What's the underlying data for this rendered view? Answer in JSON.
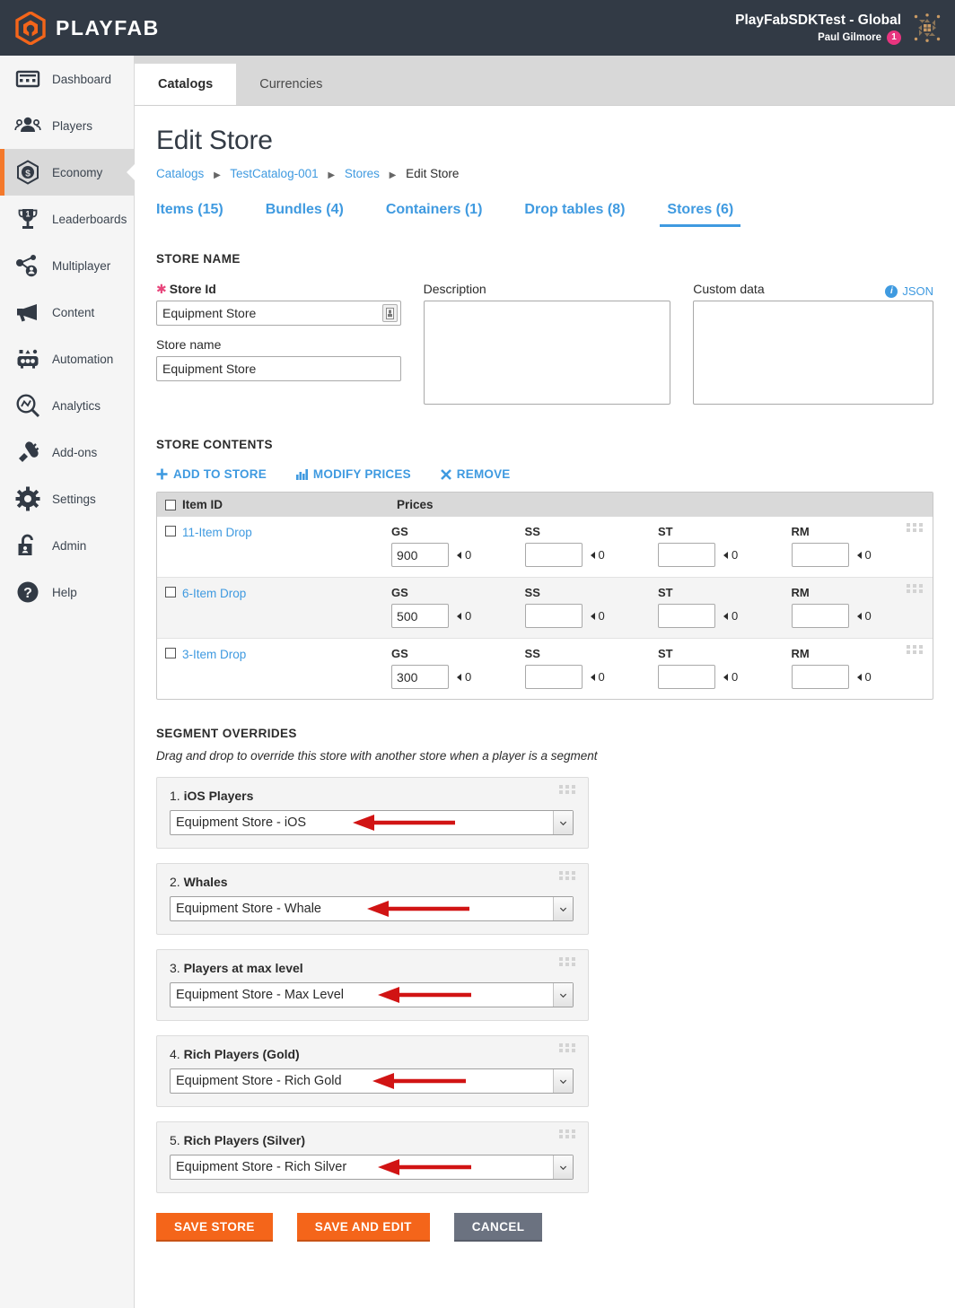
{
  "topbar": {
    "brand": "PLAYFAB",
    "studio_title": "PlayFabSDKTest - Global",
    "user_name": "Paul Gilmore",
    "notification_count": "1"
  },
  "sidebar": {
    "items": [
      {
        "label": "Dashboard",
        "icon": "dashboard-icon",
        "active": false
      },
      {
        "label": "Players",
        "icon": "players-icon",
        "active": false
      },
      {
        "label": "Economy",
        "icon": "economy-icon",
        "active": true
      },
      {
        "label": "Leaderboards",
        "icon": "trophy-icon",
        "active": false
      },
      {
        "label": "Multiplayer",
        "icon": "multiplayer-icon",
        "active": false
      },
      {
        "label": "Content",
        "icon": "megaphone-icon",
        "active": false
      },
      {
        "label": "Automation",
        "icon": "automation-icon",
        "active": false
      },
      {
        "label": "Analytics",
        "icon": "analytics-icon",
        "active": false
      },
      {
        "label": "Add-ons",
        "icon": "plug-icon",
        "active": false
      },
      {
        "label": "Settings",
        "icon": "gear-icon",
        "active": false
      },
      {
        "label": "Admin",
        "icon": "lock-icon",
        "active": false
      },
      {
        "label": "Help",
        "icon": "help-icon",
        "active": false
      }
    ]
  },
  "tabs": [
    {
      "label": "Catalogs",
      "active": true
    },
    {
      "label": "Currencies",
      "active": false
    }
  ],
  "page": {
    "title": "Edit Store",
    "breadcrumb": [
      {
        "label": "Catalogs",
        "link": true
      },
      {
        "label": "TestCatalog-001",
        "link": true
      },
      {
        "label": "Stores",
        "link": true
      },
      {
        "label": "Edit Store",
        "link": false
      }
    ],
    "subtabs": [
      {
        "label": "Items (15)",
        "active": false
      },
      {
        "label": "Bundles (4)",
        "active": false
      },
      {
        "label": "Containers (1)",
        "active": false
      },
      {
        "label": "Drop tables (8)",
        "active": false
      },
      {
        "label": "Stores (6)",
        "active": true
      }
    ]
  },
  "store_name": {
    "heading": "STORE NAME",
    "store_id_label": "Store Id",
    "store_id_value": "Equipment Store",
    "store_name_label": "Store name",
    "store_name_value": "Equipment Store",
    "description_label": "Description",
    "description_value": "",
    "custom_data_label": "Custom data",
    "custom_data_value": "",
    "json_link": "JSON"
  },
  "store_contents": {
    "heading": "STORE CONTENTS",
    "toolbar": [
      {
        "label": "ADD TO STORE",
        "icon": "plus-icon"
      },
      {
        "label": "MODIFY PRICES",
        "icon": "bar-chart-icon"
      },
      {
        "label": "REMOVE",
        "icon": "close-x-icon"
      }
    ],
    "columns": [
      "Item ID",
      "Prices"
    ],
    "price_columns": [
      "GS",
      "SS",
      "ST",
      "RM"
    ],
    "rows": [
      {
        "item_id": "11-Item Drop",
        "prices": [
          "900",
          "",
          "",
          ""
        ],
        "secondary": [
          "0",
          "0",
          "0",
          "0"
        ]
      },
      {
        "item_id": "6-Item Drop",
        "prices": [
          "500",
          "",
          "",
          ""
        ],
        "secondary": [
          "0",
          "0",
          "0",
          "0"
        ]
      },
      {
        "item_id": "3-Item Drop",
        "prices": [
          "300",
          "",
          "",
          ""
        ],
        "secondary": [
          "0",
          "0",
          "0",
          "0"
        ]
      }
    ]
  },
  "segment_overrides": {
    "heading": "SEGMENT OVERRIDES",
    "description": "Drag and drop to override this store with another store when a player is a segment",
    "cards": [
      {
        "index": "1.",
        "name": "iOS Players",
        "selected": "Equipment Store - iOS"
      },
      {
        "index": "2.",
        "name": "Whales",
        "selected": "Equipment Store - Whale"
      },
      {
        "index": "3.",
        "name": "Players at max level",
        "selected": "Equipment Store - Max Level"
      },
      {
        "index": "4.",
        "name": "Rich Players (Gold)",
        "selected": "Equipment Store - Rich Gold"
      },
      {
        "index": "5.",
        "name": "Rich Players (Silver)",
        "selected": "Equipment Store - Rich Silver"
      }
    ]
  },
  "actions": {
    "save_store": "SAVE STORE",
    "save_and_edit": "SAVE AND EDIT",
    "cancel": "CANCEL"
  },
  "colors": {
    "brand_orange": "#f4651a",
    "link_blue": "#3f9ae0",
    "dark_navy": "#323a45",
    "badge_pink": "#e8357f",
    "annotation_red": "#d11414"
  }
}
